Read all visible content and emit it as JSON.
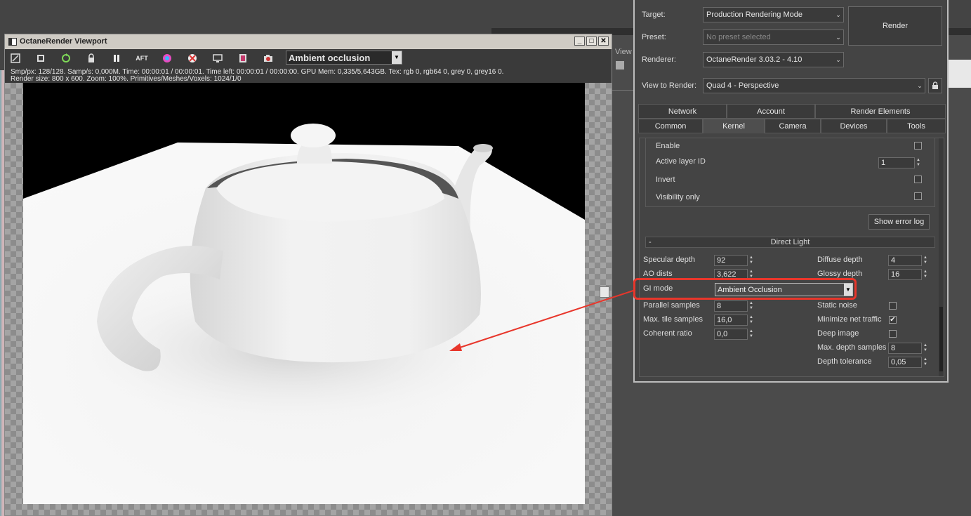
{
  "viewport": {
    "title": "OctaneRender Viewport",
    "win_buttons": {
      "minimize": "_",
      "maximize": "□",
      "close": "✕"
    },
    "toolbar": {
      "render_mode_label": "Ambient occlusion",
      "aft_label": "AFT"
    },
    "info_line1": "Smp/px: 128/128.   Samp/s: 0,000M.   Time: 00:00:01 / 00:00:01.   Time left: 00:00:01 / 00:00:00.   GPU Mem: 0,335/5,643GB.   Tex: rgb 0, rgb64 0, grey 0, grey16 0.",
    "info_line2": "Render size: 800 x 600.   Zoom: 100%.   Primitives/Meshes/Voxels: 1024/1/0"
  },
  "background": {
    "view_label": "View"
  },
  "render_setup": {
    "target_label": "Target:",
    "target_value": "Production Rendering Mode",
    "preset_label": "Preset:",
    "preset_value": "No preset selected",
    "renderer_label": "Renderer:",
    "renderer_value": "OctaneRender 3.03.2 - 4.10",
    "view_label": "View to Render:",
    "view_value": "Quad 4 - Perspective",
    "render_button": "Render",
    "tabs_row1": [
      "Network",
      "Account",
      "Render Elements"
    ],
    "tabs_row2": [
      "Common",
      "Kernel",
      "Camera",
      "Devices",
      "Tools"
    ],
    "active_tab": "Kernel",
    "layer": {
      "enable_label": "Enable",
      "active_layer_label": "Active layer ID",
      "active_layer_value": "1",
      "invert_label": "Invert",
      "visibility_label": "Visibility only",
      "show_error_log": "Show error log"
    },
    "direct_light": {
      "rollout_minus": "-",
      "title": "Direct Light",
      "specular_depth_label": "Specular depth",
      "specular_depth": "92",
      "diffuse_depth_label": "Diffuse depth",
      "diffuse_depth": "4",
      "ao_dists_label": "AO dists",
      "ao_dists": "3,622",
      "glossy_depth_label": "Glossy depth",
      "glossy_depth": "16",
      "gi_mode_label": "GI mode",
      "gi_mode": "Ambient Occlusion",
      "parallel_samples_label": "Parallel samples",
      "parallel_samples": "8",
      "static_noise_label": "Static noise",
      "max_tile_label": "Max. tile samples",
      "max_tile": "16,0",
      "minimize_net_label": "Minimize net traffic",
      "minimize_net_checked": true,
      "coherent_label": "Coherent ratio",
      "coherent": "0,0",
      "deep_image_label": "Deep image",
      "max_depth_samples_label": "Max. depth samples",
      "max_depth_samples": "8",
      "depth_tolerance_label": "Depth tolerance",
      "depth_tolerance": "0,05"
    }
  },
  "colors": {
    "highlight": "#e8362b",
    "panel_bg": "#444444"
  }
}
